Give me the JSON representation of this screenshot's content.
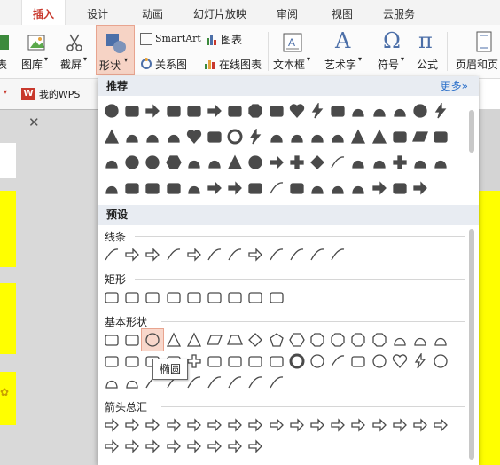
{
  "tabs": [
    "插入",
    "设计",
    "动画",
    "幻灯片放映",
    "审阅",
    "视图",
    "云服务"
  ],
  "ribbon": {
    "table_fragment": "表",
    "picture_lib": "图库",
    "screenshot": "截屏",
    "shapes": "形状",
    "smartart": "SmartArt",
    "chart": "图表",
    "relation": "关系图",
    "online_chart": "在线图表",
    "textbox": "文本框",
    "wordart": "艺术字",
    "symbol": "符号",
    "formula": "公式",
    "header_footer": "页眉和页"
  },
  "quickbar": {
    "wps_label": "我的WPS"
  },
  "popup": {
    "recommended_title": "推荐",
    "more_label": "更多",
    "preset_title": "预设",
    "categories": {
      "lines": "线条",
      "rectangles": "矩形",
      "basic": "基本形状",
      "arrows": "箭头总汇"
    },
    "tooltip": "椭圆"
  },
  "colors": {
    "accent": "#c8382c",
    "slide_yellow": "#ffff00",
    "link_blue": "#2a6fc9",
    "icon_gray": "#4a4a4a"
  },
  "icons": {
    "recommended": [
      "circle",
      "rounded-rect",
      "pentagon-arrow",
      "capsule",
      "rect-callout",
      "curved-arrow",
      "rounded-square",
      "octagon",
      "rect",
      "heart",
      "lightning",
      "square",
      "cloud-callout",
      "drop",
      "crowd",
      "oval",
      "lightning2",
      "triangle",
      "people",
      "cloud-people",
      "phone",
      "heart-outline",
      "rect-plain",
      "ring",
      "bolt-star",
      "bird",
      "person",
      "doc",
      "moon-star",
      "crown-tri",
      "snowflake-tri",
      "square2",
      "parallelogram",
      "rounded-sq2",
      "book",
      "sun",
      "circle2",
      "hexagon",
      "money-bag",
      "monitor",
      "triangle-outline",
      "circle-outline",
      "arrow-right-thick",
      "plus",
      "diamond",
      "brace",
      "pin",
      "check",
      "cross",
      "question",
      "pie",
      "laptop",
      "corner",
      "square3",
      "chart-bars",
      "people2",
      "arrow-right",
      "arrow-right2",
      "rect2",
      "line-chart",
      "square4",
      "doc2",
      "hand",
      "money-bag2",
      "double-arrow",
      "rect3",
      "arrow-right3"
    ],
    "lines": [
      "line",
      "arrow-line",
      "double-arrow-line",
      "elbow",
      "elbow-arrow",
      "elbow-double",
      "curve",
      "curve-arrow",
      "curve-double",
      "s-curve",
      "freeform",
      "scribble"
    ],
    "rectangles": [
      "rect",
      "rounded-rect",
      "snip-rect",
      "snip2-rect",
      "round-snip-rect",
      "round1-rect",
      "round2-rect",
      "round-diag-rect",
      "rect-plain2"
    ],
    "basic": [
      "text-box",
      "vertical-text",
      "oval",
      "triangle",
      "right-triangle",
      "parallelogram",
      "trapezoid",
      "diamond",
      "pentagon",
      "hexagon",
      "heptagon",
      "octagon",
      "decagon",
      "dodecagon",
      "pie",
      "chord",
      "teardrop",
      "frame",
      "half-frame",
      "l-shape",
      "diag-stripe",
      "cross",
      "plaque",
      "can",
      "cube",
      "bevel",
      "donut",
      "no-symbol",
      "block-arc",
      "folded-corner",
      "smiley",
      "heart",
      "lightning",
      "sun",
      "moon",
      "cloud",
      "arc",
      "double-bracket",
      "double-brace",
      "left-bracket",
      "right-bracket",
      "left-brace",
      "right-brace"
    ],
    "arrows": [
      "right-arrow",
      "left-arrow",
      "up-arrow",
      "down-arrow",
      "left-right-arrow",
      "up-down-arrow",
      "quad-arrow",
      "left-right-up-arrow",
      "bent-arrow",
      "u-turn-arrow",
      "left-up-arrow",
      "bent-up-arrow",
      "curved-right-arrow",
      "curved-left-arrow",
      "curved-up-arrow",
      "curved-down-arrow",
      "striped-right-arrow",
      "notched-right-arrow",
      "pentagon-arrow",
      "chevron",
      "right-arrow-callout",
      "down-arrow-callout",
      "left-arrow-callout",
      "quad-arrow-callout",
      "circular-arrow"
    ]
  }
}
